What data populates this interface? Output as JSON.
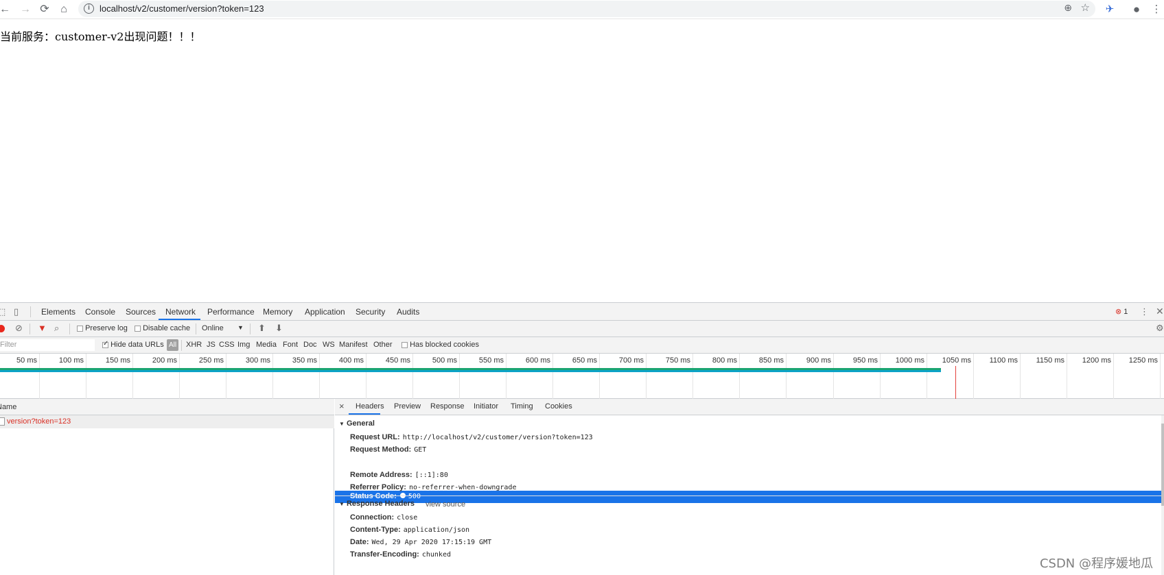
{
  "browser": {
    "url_host": "localhost",
    "url_path": "/v2/customer/version?token=123"
  },
  "page": {
    "message": "当前服务：customer-v2出现问题！！！"
  },
  "devtools": {
    "tabs": [
      "Elements",
      "Console",
      "Sources",
      "Network",
      "Performance",
      "Memory",
      "Application",
      "Security",
      "Audits"
    ],
    "active_tab": "Network",
    "error_count": "1",
    "toolbar": {
      "preserve_log": "Preserve log",
      "disable_cache": "Disable cache",
      "throttling": "Online"
    },
    "filter": {
      "placeholder": "Filter",
      "hide_data_urls": "Hide data URLs",
      "all": "All",
      "types": [
        "XHR",
        "JS",
        "CSS",
        "Img",
        "Media",
        "Font",
        "Doc",
        "WS",
        "Manifest",
        "Other"
      ],
      "has_blocked_cookies": "Has blocked cookies"
    },
    "timeline": {
      "ticks": [
        "50 ms",
        "100 ms",
        "150 ms",
        "200 ms",
        "250 ms",
        "300 ms",
        "350 ms",
        "400 ms",
        "450 ms",
        "500 ms",
        "550 ms",
        "600 ms",
        "650 ms",
        "700 ms",
        "750 ms",
        "800 ms",
        "850 ms",
        "900 ms",
        "950 ms",
        "1000 ms",
        "1050 ms",
        "1100 ms",
        "1150 ms",
        "1200 ms",
        "1250 ms"
      ]
    },
    "requests": {
      "column_name": "Name",
      "rows": [
        {
          "name": "version?token=123",
          "color": "#d93025"
        }
      ]
    },
    "detail": {
      "tabs": [
        "Headers",
        "Preview",
        "Response",
        "Initiator",
        "Timing",
        "Cookies"
      ],
      "active_tab": "Headers",
      "general_title": "General",
      "general": [
        {
          "name": "Request URL:",
          "value": "http://localhost/v2/customer/version?token=123"
        },
        {
          "name": "Request Method:",
          "value": "GET"
        },
        {
          "name": "Status Code:",
          "value": "500"
        },
        {
          "name": "Remote Address:",
          "value": "[::1]:80"
        },
        {
          "name": "Referrer Policy:",
          "value": "no-referrer-when-downgrade"
        }
      ],
      "response_headers_title": "Response Headers",
      "view_source": "view source",
      "response_headers": [
        {
          "name": "Connection:",
          "value": "close"
        },
        {
          "name": "Content-Type:",
          "value": "application/json"
        },
        {
          "name": "Date:",
          "value": "Wed, 29 Apr 2020 17:15:19 GMT"
        },
        {
          "name": "Transfer-Encoding:",
          "value": "chunked"
        }
      ]
    }
  },
  "watermark": "CSDN @程序媛地瓜",
  "colors": {
    "accent": "#1a73e8",
    "error": "#d93025"
  }
}
